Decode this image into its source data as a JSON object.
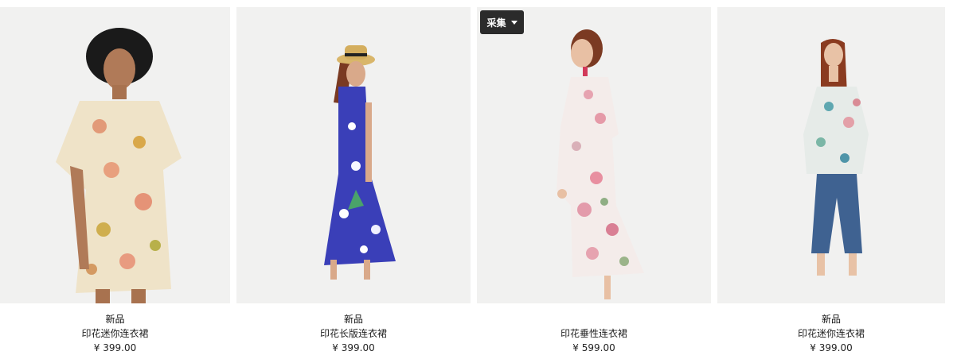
{
  "collect_button": {
    "label": "采集",
    "icon": "caret-down-icon"
  },
  "products": [
    {
      "badge": "新品",
      "name": "印花迷你连衣裙",
      "price": "¥ 399.00"
    },
    {
      "badge": "新品",
      "name": "印花长版连衣裙",
      "price": "¥ 399.00"
    },
    {
      "badge": "",
      "name": "印花垂性连衣裙",
      "price": "¥ 599.00"
    },
    {
      "badge": "新品",
      "name": "印花迷你连衣裙",
      "price": "¥ 399.00"
    }
  ],
  "colors": {
    "photo_background": "#f1f1f0",
    "button_background": "#2b2b2b",
    "text": "#222222"
  }
}
